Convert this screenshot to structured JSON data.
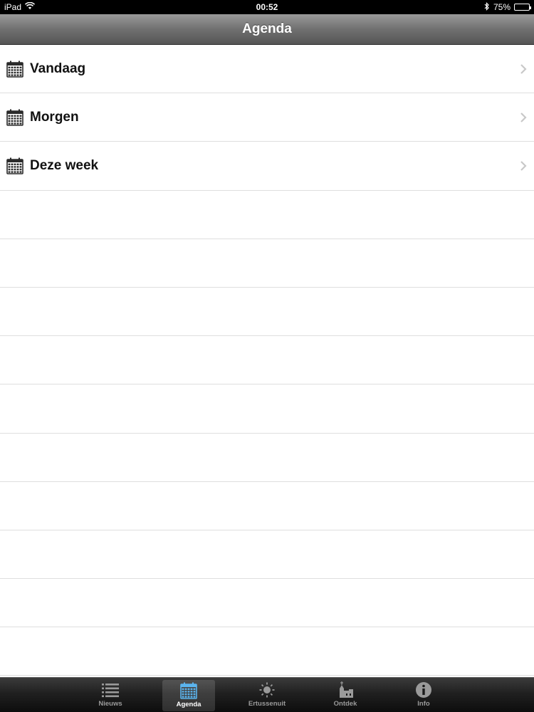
{
  "status_bar": {
    "device": "iPad",
    "time": "00:52",
    "battery": "75%",
    "battery_level": 0.75,
    "icons": [
      "wifi-icon",
      "bluetooth-icon",
      "battery-icon"
    ]
  },
  "nav_bar": {
    "title": "Agenda"
  },
  "list": {
    "items": [
      {
        "label": "Vandaag",
        "icon": "calendar-icon"
      },
      {
        "label": "Morgen",
        "icon": "calendar-icon"
      },
      {
        "label": "Deze week",
        "icon": "calendar-icon"
      }
    ]
  },
  "tab_bar": {
    "tabs": [
      {
        "label": "Nieuws",
        "icon": "list-icon",
        "active": false
      },
      {
        "label": "Agenda",
        "icon": "calendar-icon",
        "active": true
      },
      {
        "label": "Ertussenuit",
        "icon": "sun-icon",
        "active": false
      },
      {
        "label": "Ontdek",
        "icon": "church-icon",
        "active": false
      },
      {
        "label": "Info",
        "icon": "info-icon",
        "active": false
      }
    ]
  },
  "colors": {
    "active_tab_icon": "#5bb4ee",
    "inactive_tab": "#9a9a9a"
  }
}
